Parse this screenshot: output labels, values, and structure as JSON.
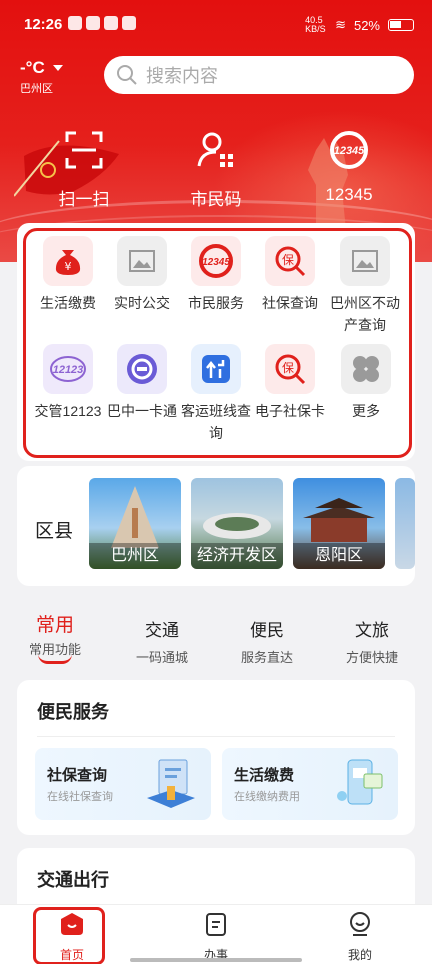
{
  "status_bar": {
    "time": "12:26",
    "network": "40.5 KB/S",
    "battery": "52%"
  },
  "weather": {
    "temperature": "-°C",
    "location": "巴州区"
  },
  "search": {
    "placeholder": "搜索内容"
  },
  "quick_actions": [
    {
      "label": "扫一扫",
      "icon": "scan-icon"
    },
    {
      "label": "市民码",
      "icon": "citizen-code-icon"
    },
    {
      "label": "12345",
      "icon": "hotline-12345-icon"
    }
  ],
  "services": [
    {
      "label": "生活缴费",
      "icon": "money-bag-icon"
    },
    {
      "label": "实时公交",
      "icon": "image-placeholder-icon"
    },
    {
      "label": "市民服务",
      "icon": "hotline-12345-icon"
    },
    {
      "label": "社保查询",
      "icon": "social-security-search-icon"
    },
    {
      "label": "巴州区不动产查询",
      "icon": "image-placeholder-icon"
    },
    {
      "label": "交管12123",
      "icon": "traffic-12123-icon"
    },
    {
      "label": "巴中一卡通",
      "icon": "transit-card-icon"
    },
    {
      "label": "客运班线查询",
      "icon": "route-sign-icon"
    },
    {
      "label": "电子社保卡",
      "icon": "social-security-card-icon"
    },
    {
      "label": "更多",
      "icon": "more-grid-icon"
    }
  ],
  "district": {
    "title": "区县",
    "items": [
      {
        "label": "巴州区"
      },
      {
        "label": "经济开发区"
      },
      {
        "label": "恩阳区"
      }
    ]
  },
  "category_tabs": [
    {
      "title": "常用",
      "subtitle": "常用功能",
      "active": true
    },
    {
      "title": "交通",
      "subtitle": "一码通城",
      "active": false
    },
    {
      "title": "便民",
      "subtitle": "服务直达",
      "active": false
    },
    {
      "title": "文旅",
      "subtitle": "方便快捷",
      "active": false
    }
  ],
  "convenience": {
    "title": "便民服务",
    "tiles": [
      {
        "title": "社保查询",
        "subtitle": "在线社保查询"
      },
      {
        "title": "生活缴费",
        "subtitle": "在线缴纳费用"
      }
    ]
  },
  "traffic": {
    "title": "交通出行"
  },
  "bottom_nav": [
    {
      "label": "首页",
      "active": true
    },
    {
      "label": "办事",
      "active": false
    },
    {
      "label": "我的",
      "active": false
    }
  ],
  "colors": {
    "brand_red": "#e0211c",
    "blue_tile": "#eef7ff"
  }
}
